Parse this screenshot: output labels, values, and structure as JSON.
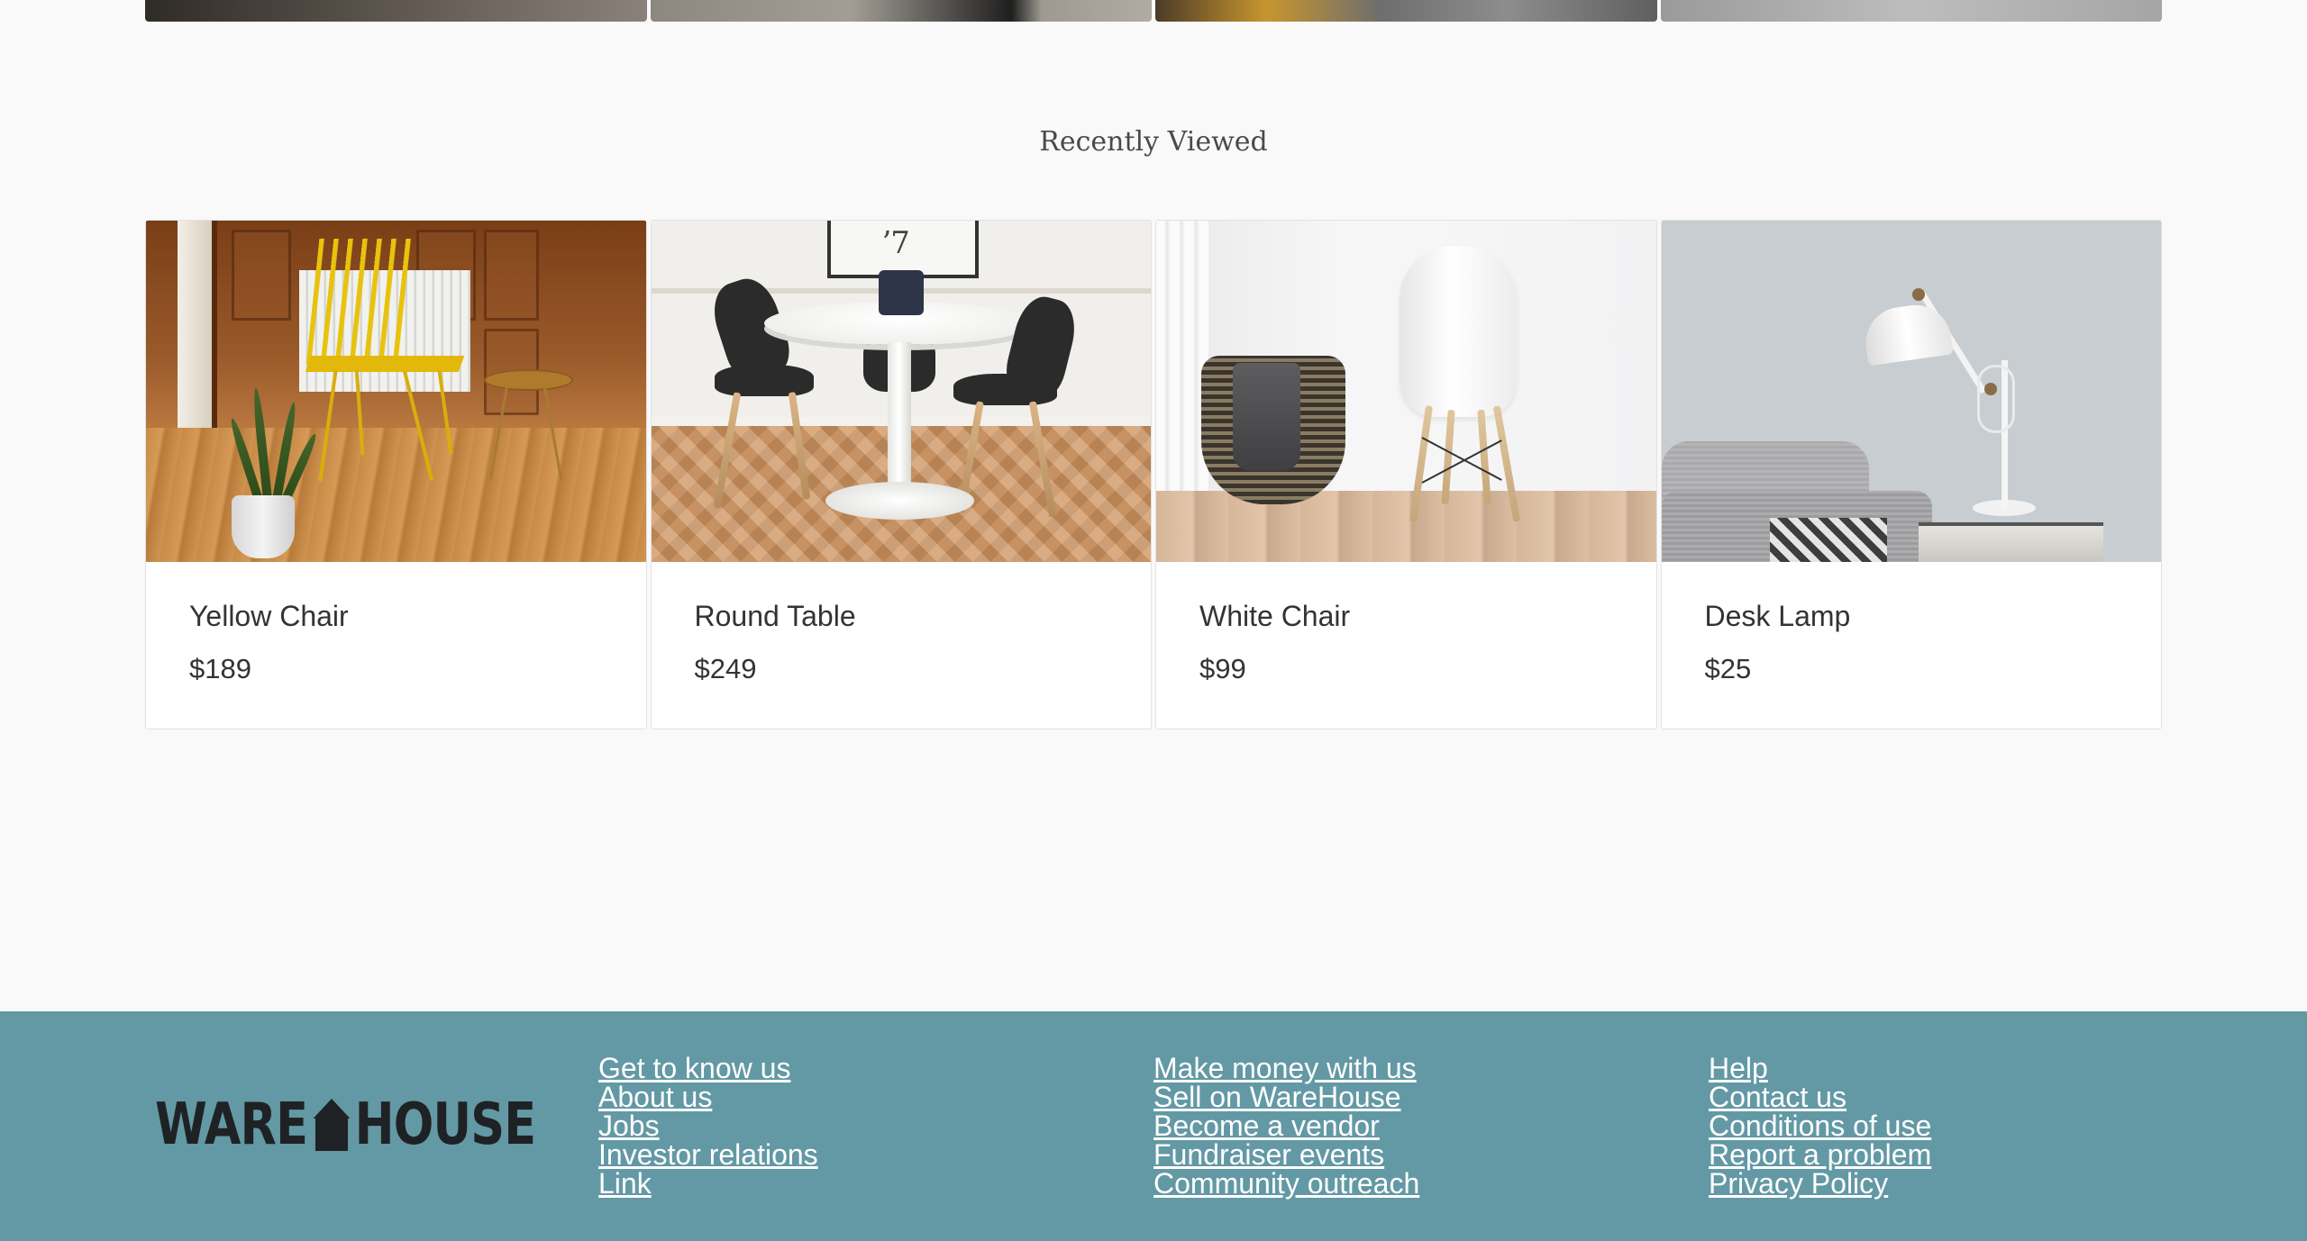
{
  "recently_viewed": {
    "title": "Recently Viewed",
    "products": [
      {
        "name": "Yellow Chair",
        "price": "$189"
      },
      {
        "name": "Round Table",
        "price": "$249"
      },
      {
        "name": "White Chair",
        "price": "$99"
      },
      {
        "name": "Desk Lamp",
        "price": "$25"
      }
    ]
  },
  "footer": {
    "logo_text_left": "WARE",
    "logo_text_right": "HOUSE",
    "columns": [
      {
        "links": [
          "Get to know us",
          "About us",
          "Jobs",
          "Investor relations",
          "Link"
        ]
      },
      {
        "links": [
          "Make money with us",
          "Sell on WareHouse",
          "Become a vendor",
          "Fundraiser events",
          "Community outreach"
        ]
      },
      {
        "links": [
          "Help",
          "Contact us",
          "Conditions of use",
          "Report a problem",
          "Privacy Policy"
        ]
      }
    ]
  },
  "colors": {
    "page_background": "#f9f9f9",
    "footer_background": "#6399a5",
    "footer_link": "#ffffff",
    "logo": "#1f2224"
  }
}
